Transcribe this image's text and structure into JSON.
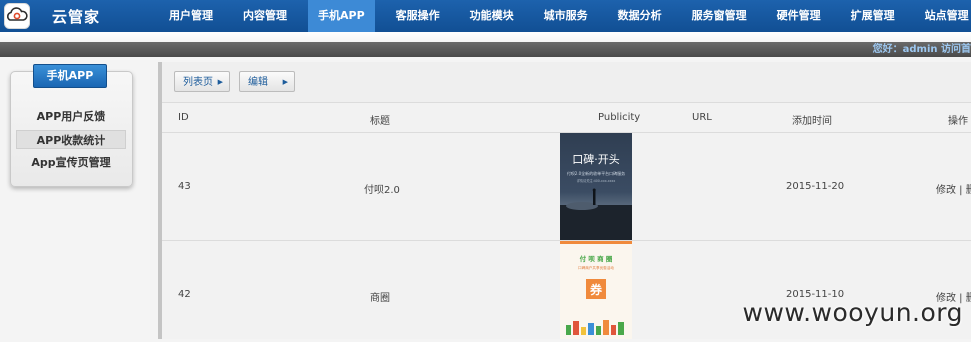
{
  "brand": {
    "name": "云管家"
  },
  "nav": {
    "items": [
      {
        "label": "用户管理"
      },
      {
        "label": "内容管理"
      },
      {
        "label": "手机APP",
        "active": true
      },
      {
        "label": "客服操作"
      },
      {
        "label": "功能模块"
      },
      {
        "label": "城市服务"
      },
      {
        "label": "数据分析"
      },
      {
        "label": "服务窗管理"
      },
      {
        "label": "硬件管理"
      },
      {
        "label": "扩展管理"
      },
      {
        "label": "站点管理"
      }
    ]
  },
  "header": {
    "welcome": "您好：admin  访问首"
  },
  "sidebar": {
    "title": "手机APP",
    "items": [
      {
        "label": "APP用户反馈"
      },
      {
        "label": "APP收款统计",
        "active": true
      },
      {
        "label": "App宣传页管理"
      }
    ]
  },
  "breadcrumb": {
    "list": "列表页",
    "edit": "编辑"
  },
  "table": {
    "headers": {
      "id": "ID",
      "title": "标题",
      "publicity": "Publicity",
      "url": "URL",
      "added": "添加时间",
      "actions": "操作"
    },
    "rows": [
      {
        "id": "43",
        "title": "付呗2.0",
        "date": "2015-11-20",
        "actions": "修改 | 删除",
        "poster": {
          "heading": "口碑·开头",
          "line": "付呗2.0全新的收单平台口碑服务",
          "small": "详情请关注:400-xxx-xxxx"
        }
      },
      {
        "id": "42",
        "title": "商圈",
        "date": "2015-11-10",
        "actions": "修改 | 删除",
        "poster": {
          "heading": "付 呗 商 圈",
          "line": "口碑商户共享优惠活动",
          "coupon": "券"
        }
      }
    ]
  },
  "watermark": "www.wooyun.org"
}
